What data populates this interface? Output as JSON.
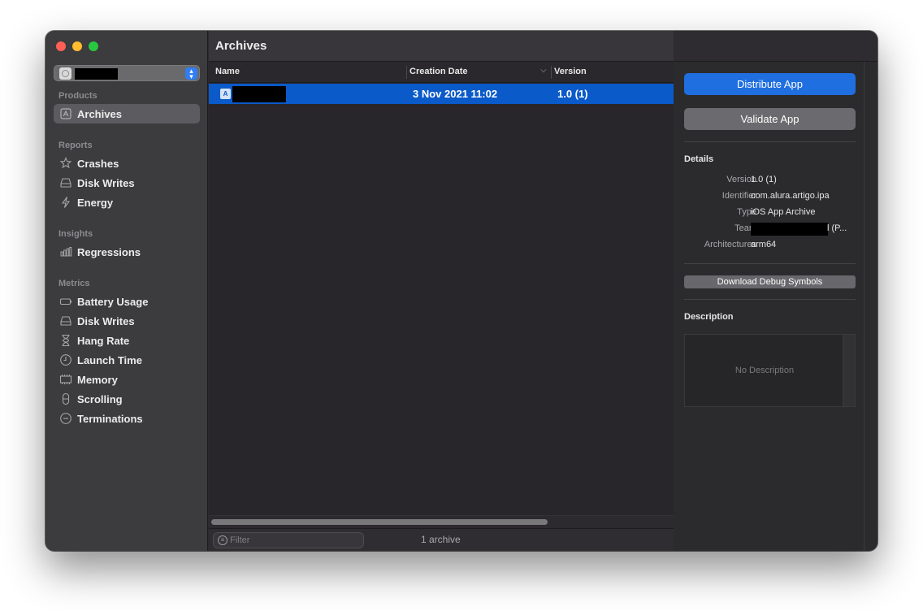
{
  "sidebar": {
    "sections": [
      {
        "title": "Products",
        "items": [
          {
            "label": "Archives",
            "icon": "archive-icon",
            "selected": true
          }
        ]
      },
      {
        "title": "Reports",
        "items": [
          {
            "label": "Crashes",
            "icon": "crash-icon"
          },
          {
            "label": "Disk Writes",
            "icon": "disk-icon"
          },
          {
            "label": "Energy",
            "icon": "bolt-icon"
          }
        ]
      },
      {
        "title": "Insights",
        "items": [
          {
            "label": "Regressions",
            "icon": "regressions-icon"
          }
        ]
      },
      {
        "title": "Metrics",
        "items": [
          {
            "label": "Battery Usage",
            "icon": "battery-icon"
          },
          {
            "label": "Disk Writes",
            "icon": "disk-icon"
          },
          {
            "label": "Hang Rate",
            "icon": "hourglass-icon"
          },
          {
            "label": "Launch Time",
            "icon": "clock-icon"
          },
          {
            "label": "Memory",
            "icon": "memory-icon"
          },
          {
            "label": "Scrolling",
            "icon": "scrolling-icon"
          },
          {
            "label": "Terminations",
            "icon": "terminations-icon"
          }
        ]
      }
    ]
  },
  "main": {
    "title": "Archives",
    "columns": {
      "name": "Name",
      "creation_date": "Creation Date",
      "version": "Version"
    },
    "rows": [
      {
        "name_redacted": true,
        "creation_date": "3 Nov 2021 11:02",
        "version": "1.0 (1)",
        "selected": true
      }
    ],
    "filter_placeholder": "Filter",
    "count": "1 archive"
  },
  "inspector": {
    "distribute_label": "Distribute App",
    "validate_label": "Validate App",
    "details_title": "Details",
    "details": {
      "version_key": "Version",
      "version": "1.0 (1)",
      "identifier_key": "Identifier",
      "identifier": "com.alura.artigo.ipa",
      "type_key": "Type",
      "type": "iOS App Archive",
      "team_key": "Team",
      "team_suffix": "l (P...",
      "architectures_key": "Architectures",
      "architectures": "arm64"
    },
    "download_label": "Download Debug Symbols",
    "description_title": "Description",
    "description_placeholder": "No Description"
  },
  "colors": {
    "accent": "#1f6fe0",
    "selection": "#0a5ac9",
    "close": "#fe5f57",
    "minimize": "#febc2e",
    "maximize": "#28c840"
  }
}
